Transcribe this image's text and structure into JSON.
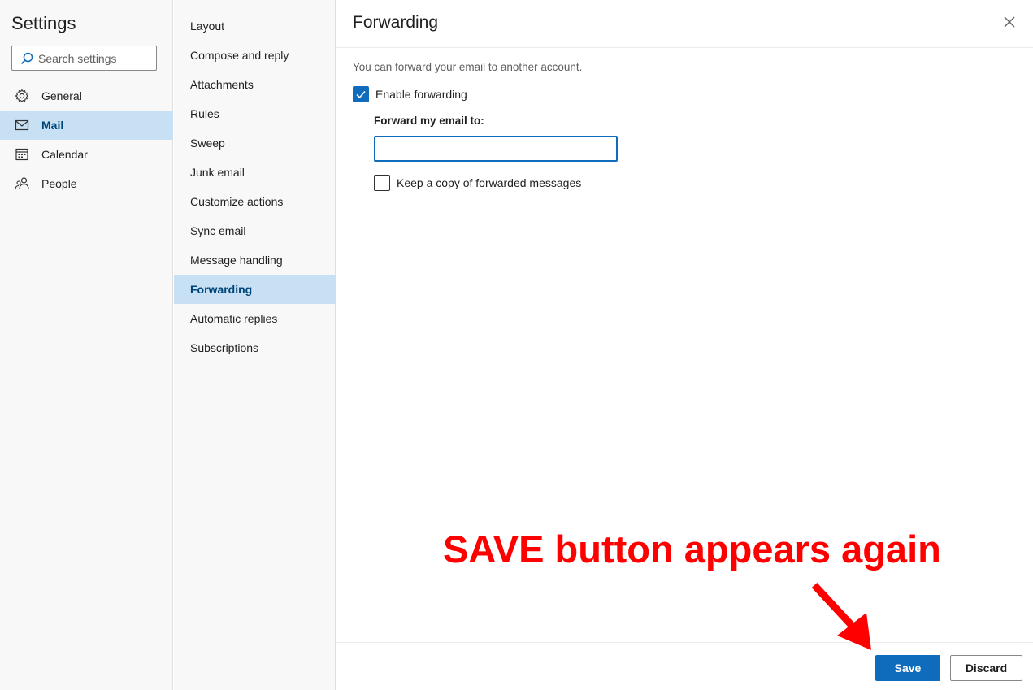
{
  "sidebar": {
    "title": "Settings",
    "search_placeholder": "Search settings",
    "categories": [
      {
        "label": "General",
        "icon": "gear-icon",
        "active": false
      },
      {
        "label": "Mail",
        "icon": "mail-icon",
        "active": true
      },
      {
        "label": "Calendar",
        "icon": "calendar-icon",
        "active": false
      },
      {
        "label": "People",
        "icon": "people-icon",
        "active": false
      }
    ]
  },
  "subnav": {
    "items": [
      {
        "label": "Layout",
        "active": false
      },
      {
        "label": "Compose and reply",
        "active": false
      },
      {
        "label": "Attachments",
        "active": false
      },
      {
        "label": "Rules",
        "active": false
      },
      {
        "label": "Sweep",
        "active": false
      },
      {
        "label": "Junk email",
        "active": false
      },
      {
        "label": "Customize actions",
        "active": false
      },
      {
        "label": "Sync email",
        "active": false
      },
      {
        "label": "Message handling",
        "active": false
      },
      {
        "label": "Forwarding",
        "active": true
      },
      {
        "label": "Automatic replies",
        "active": false
      },
      {
        "label": "Subscriptions",
        "active": false
      }
    ]
  },
  "content": {
    "title": "Forwarding",
    "intro": "You can forward your email to another account.",
    "enable_forwarding": {
      "label": "Enable forwarding",
      "checked": true
    },
    "forward_to": {
      "label": "Forward my email to:",
      "value": ""
    },
    "keep_copy": {
      "label": "Keep a copy of forwarded messages",
      "checked": false
    }
  },
  "footer": {
    "save_label": "Save",
    "discard_label": "Discard"
  },
  "annotation": {
    "text": "SAVE button appears again",
    "color": "#ff0000"
  },
  "colors": {
    "accent": "#0f6cbd",
    "selected_bg": "#c7e0f4",
    "selected_text": "#004578"
  }
}
